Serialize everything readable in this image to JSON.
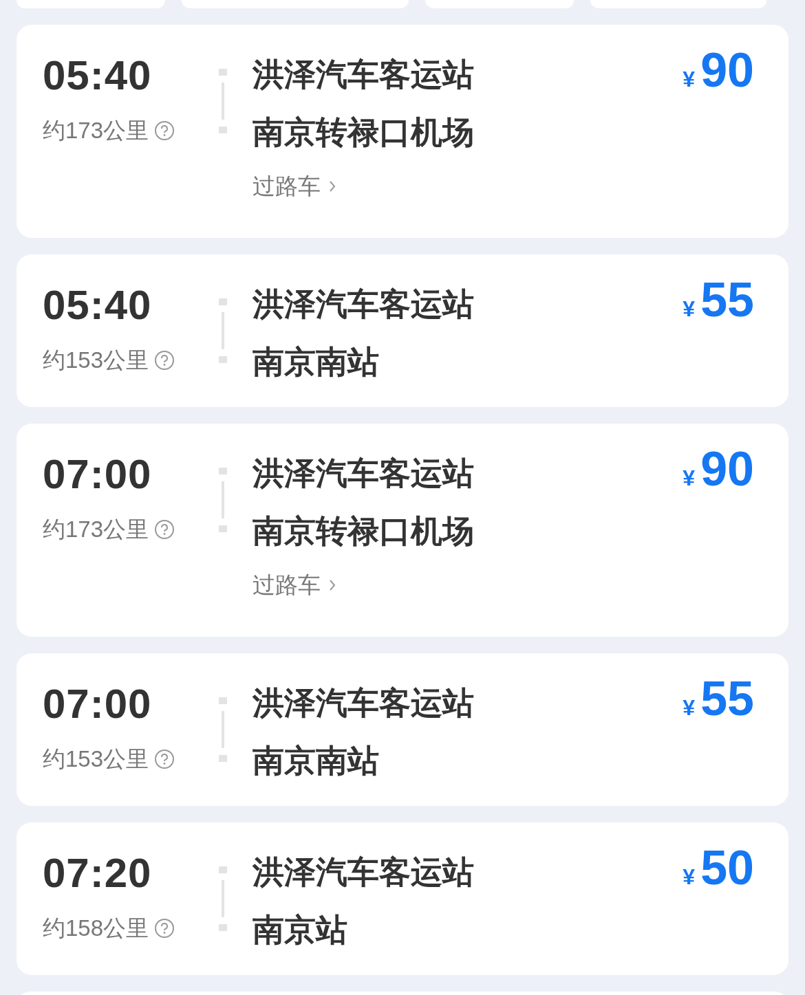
{
  "top_cards": [
    {
      "kind": "partial"
    },
    {
      "kind": "partial"
    },
    {
      "kind": "partial"
    },
    {
      "kind": "partial"
    }
  ],
  "trips": [
    {
      "time": "05:40",
      "distance": "约173公里",
      "from": "洪泽汽车客运站",
      "to": "南京转禄口机场",
      "tag": "过路车",
      "currency": "¥",
      "price": "90"
    },
    {
      "time": "05:40",
      "distance": "约153公里",
      "from": "洪泽汽车客运站",
      "to": "南京南站",
      "currency": "¥",
      "price": "55"
    },
    {
      "time": "07:00",
      "distance": "约173公里",
      "from": "洪泽汽车客运站",
      "to": "南京转禄口机场",
      "tag": "过路车",
      "currency": "¥",
      "price": "90"
    },
    {
      "time": "07:00",
      "distance": "约153公里",
      "from": "洪泽汽车客运站",
      "to": "南京南站",
      "currency": "¥",
      "price": "55"
    },
    {
      "time": "07:20",
      "distance": "约158公里",
      "from": "洪泽汽车客运站",
      "to": "南京站",
      "currency": "¥",
      "price": "50"
    }
  ],
  "bottom_card": {
    "kind": "partial"
  }
}
